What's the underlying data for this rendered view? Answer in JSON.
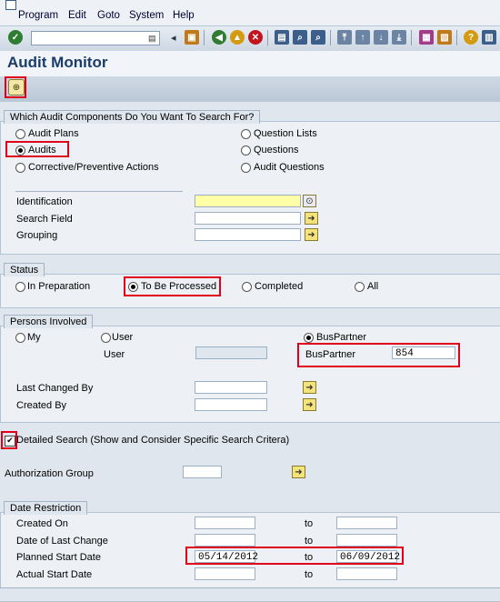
{
  "menu": [
    "Program",
    "Edit",
    "Goto",
    "System",
    "Help"
  ],
  "toolbar": {
    "command_value": ""
  },
  "title": "Audit Monitor",
  "components": {
    "heading": "Which Audit Components Do You Want To Search For?",
    "options": [
      {
        "label": "Audit Plans",
        "selected": false
      },
      {
        "label": "Audits",
        "selected": true
      },
      {
        "label": "Corrective/Preventive Actions",
        "selected": false
      },
      {
        "label": "Question Lists",
        "selected": false
      },
      {
        "label": "Questions",
        "selected": false
      },
      {
        "label": "Audit Questions",
        "selected": false
      }
    ],
    "fields": [
      {
        "label": "Identification",
        "value": ""
      },
      {
        "label": "Search Field",
        "value": ""
      },
      {
        "label": "Grouping",
        "value": ""
      }
    ]
  },
  "status": {
    "heading": "Status",
    "options": [
      {
        "label": "In Preparation",
        "selected": false
      },
      {
        "label": "To Be Processed",
        "selected": true
      },
      {
        "label": "Completed",
        "selected": false
      },
      {
        "label": "All",
        "selected": false
      }
    ]
  },
  "persons": {
    "heading": "Persons Involved",
    "options": [
      {
        "label": "My",
        "selected": false
      },
      {
        "label": "User",
        "selected": false
      },
      {
        "label": "BusPartner",
        "selected": true
      }
    ],
    "user_label": "User",
    "user_value": "",
    "buspartner_label": "BusPartner",
    "buspartner_value": "854",
    "last_changed_label": "Last Changed By",
    "last_changed_value": "",
    "created_by_label": "Created By",
    "created_by_value": ""
  },
  "detailed_search": {
    "label": "Detailed Search (Show and Consider Specific Search Critera)",
    "checked": true,
    "mark": "✔"
  },
  "auth_group": {
    "label": "Authorization Group",
    "value": ""
  },
  "date_restriction": {
    "heading": "Date Restriction",
    "to_label": "to",
    "rows": [
      {
        "label": "Created On",
        "from": "",
        "to": ""
      },
      {
        "label": "Date of Last Change",
        "from": "",
        "to": ""
      },
      {
        "label": "Planned Start Date",
        "from": "05/14/2012",
        "to": "06/09/2012"
      },
      {
        "label": "Actual Start Date",
        "from": "",
        "to": ""
      }
    ]
  },
  "icons": {
    "exec": "execute-icon",
    "arrow": "multiple-selection-arrow-icon"
  }
}
